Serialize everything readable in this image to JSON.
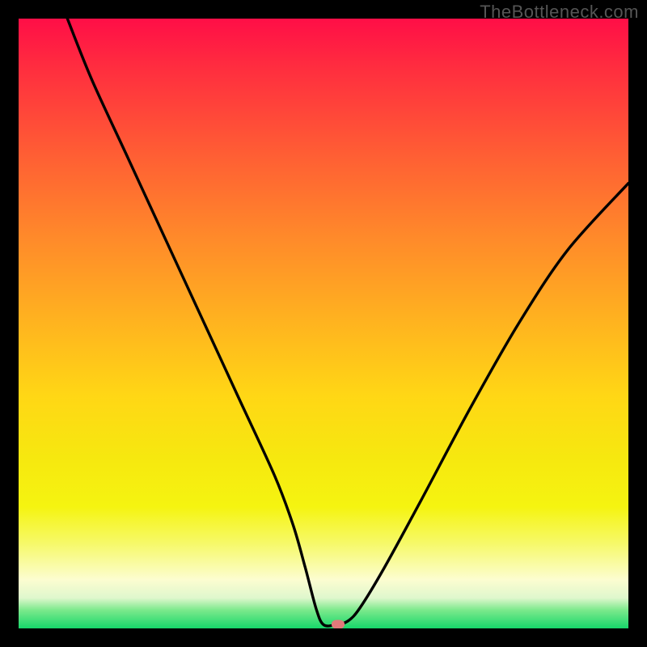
{
  "watermark": "TheBottleneck.com",
  "chart_data": {
    "type": "line",
    "title": "",
    "xlabel": "",
    "ylabel": "",
    "xlim": [
      0,
      100
    ],
    "ylim": [
      0,
      100
    ],
    "grid": false,
    "series": [
      {
        "name": "bottleneck-curve",
        "x": [
          8,
          12,
          18,
          24,
          30,
          36,
          42,
          45,
          47,
          48.8,
          50,
          52,
          54,
          56,
          60,
          66,
          74,
          82,
          90,
          100
        ],
        "values": [
          100,
          90,
          77,
          64,
          51,
          38,
          25,
          17,
          10,
          3.2,
          0.6,
          0.6,
          1.2,
          3.4,
          10,
          21,
          36,
          50,
          62,
          73
        ]
      }
    ],
    "marker": {
      "x": 52.4,
      "y": 0.6,
      "color": "#e17a7a"
    },
    "background_gradient_stops": [
      {
        "pos": 0,
        "color": "#ff0e47"
      },
      {
        "pos": 8,
        "color": "#ff2d3f"
      },
      {
        "pos": 22,
        "color": "#ff5d34"
      },
      {
        "pos": 36,
        "color": "#ff8a2a"
      },
      {
        "pos": 50,
        "color": "#ffb41f"
      },
      {
        "pos": 62,
        "color": "#ffd715"
      },
      {
        "pos": 72,
        "color": "#f6e80f"
      },
      {
        "pos": 80,
        "color": "#f5f410"
      },
      {
        "pos": 86,
        "color": "#f6f968"
      },
      {
        "pos": 92,
        "color": "#fcfdd0"
      },
      {
        "pos": 95,
        "color": "#dff7cd"
      },
      {
        "pos": 97,
        "color": "#7be98c"
      },
      {
        "pos": 100,
        "color": "#17d76a"
      }
    ]
  }
}
